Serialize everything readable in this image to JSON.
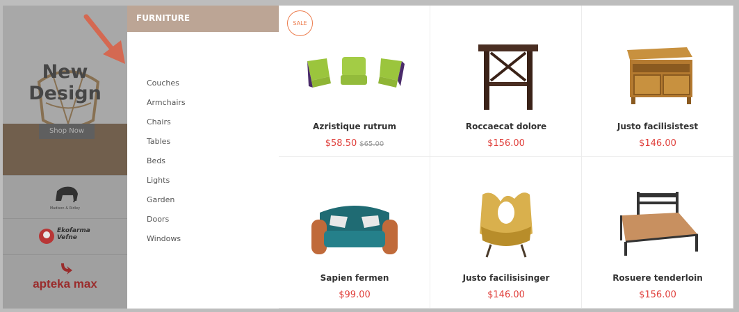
{
  "banner": {
    "title": "New Design",
    "button_label": "Shop Now"
  },
  "brands": [
    {
      "name": "Madison & Ridley",
      "icon": "elephant-logo-icon"
    },
    {
      "name": "Ekofarma Vefne",
      "icon": "ekofarma-logo-icon"
    },
    {
      "name": "apteka max",
      "icon": "apteka-max-logo-icon"
    }
  ],
  "category_panel": {
    "title": "FURNITURE",
    "items": [
      "Couches",
      "Armchairs",
      "Chairs",
      "Tables",
      "Beds",
      "Lights",
      "Garden",
      "Doors",
      "Windows"
    ]
  },
  "products": [
    {
      "name": "Azristique rutrum",
      "price": "$58.50",
      "old_price": "$65.00",
      "badge": "SALE",
      "image": "modular-seats-icon"
    },
    {
      "name": "Roccaecat dolore",
      "price": "$156.00",
      "image": "side-table-icon"
    },
    {
      "name": "Justo facilisistest",
      "price": "$146.00",
      "image": "tv-cabinet-icon"
    },
    {
      "name": "Sapien fermen",
      "price": "$99.00",
      "image": "sofa-icon"
    },
    {
      "name": "Justo facilisisinger",
      "price": "$146.00",
      "image": "armchair-icon"
    },
    {
      "name": "Rosuere tenderloin",
      "price": "$156.00",
      "image": "bed-icon"
    }
  ],
  "colors": {
    "category_header": "#bca595",
    "price": "#e0403c",
    "sale_badge": "#ec7c4d",
    "arrow": "#e8664a"
  }
}
